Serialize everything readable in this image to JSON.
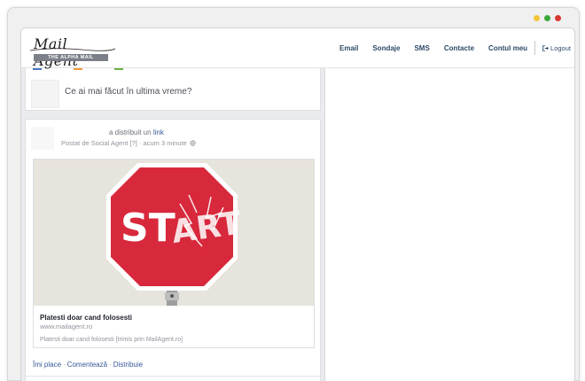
{
  "window": {
    "dot_colors": [
      "#f2c63a",
      "#3aaa3a",
      "#d9362f"
    ]
  },
  "header": {
    "logo_script": "Mail Agent",
    "logo_tag": "THE ALPHA MAIL",
    "nav": [
      {
        "label": "Email"
      },
      {
        "label": "Sondaje"
      },
      {
        "label": "SMS"
      },
      {
        "label": "Contacte"
      },
      {
        "label": "Contul meu"
      }
    ],
    "logout_label": "Logout",
    "logout_icon": "logout-icon"
  },
  "status": {
    "prompt": "Ce ai mai făcut în ultima vreme?",
    "tab_colors": [
      "#4a76c9",
      "#f29b3a",
      "#6cb33f"
    ]
  },
  "post": {
    "shared_text": "a distribuit un",
    "shared_link": "link",
    "meta_text": "Postat de Social Agent [?] · acum 3 minute",
    "privacy_icon": "globe-icon",
    "image": {
      "sign_text_left": "ST",
      "sign_text_right": "ART",
      "sign_color": "#d8283c"
    },
    "link_title": "Platesti doar cand folosesti",
    "link_domain": "www.mailagent.ro",
    "link_description": "Platesti doar cand folosesti [trimis prin MailAgent.ro]",
    "actions": [
      {
        "label": "Îmi place"
      },
      {
        "label": "Comentează"
      },
      {
        "label": "Distribuie"
      }
    ]
  }
}
